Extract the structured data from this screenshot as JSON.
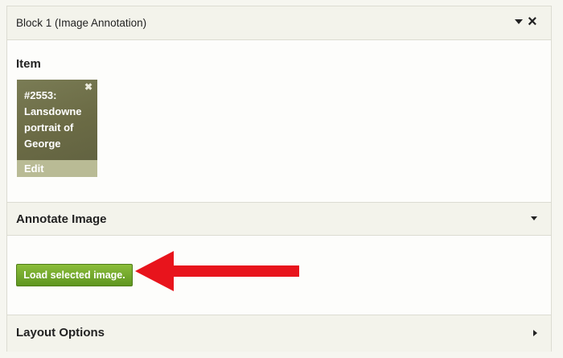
{
  "block": {
    "title": "Block 1 (Image Annotation)",
    "collapse_icon": "chevron-down-icon",
    "close_icon": "close-icon"
  },
  "item_section": {
    "label": "Item",
    "thumbnail": {
      "title": "#2553: Lansdowne portrait of George",
      "remove_icon": "close-icon",
      "edit_label": "Edit"
    }
  },
  "annotate_section": {
    "title": "Annotate Image",
    "toggle_icon": "chevron-down-icon",
    "button_label": "Load selected image."
  },
  "layout_section": {
    "title": "Layout Options",
    "toggle_icon": "chevron-right-icon"
  },
  "colors": {
    "button_green": "#6ea72a",
    "arrow_red": "#e8141c",
    "header_bg": "#f3f3eb"
  }
}
